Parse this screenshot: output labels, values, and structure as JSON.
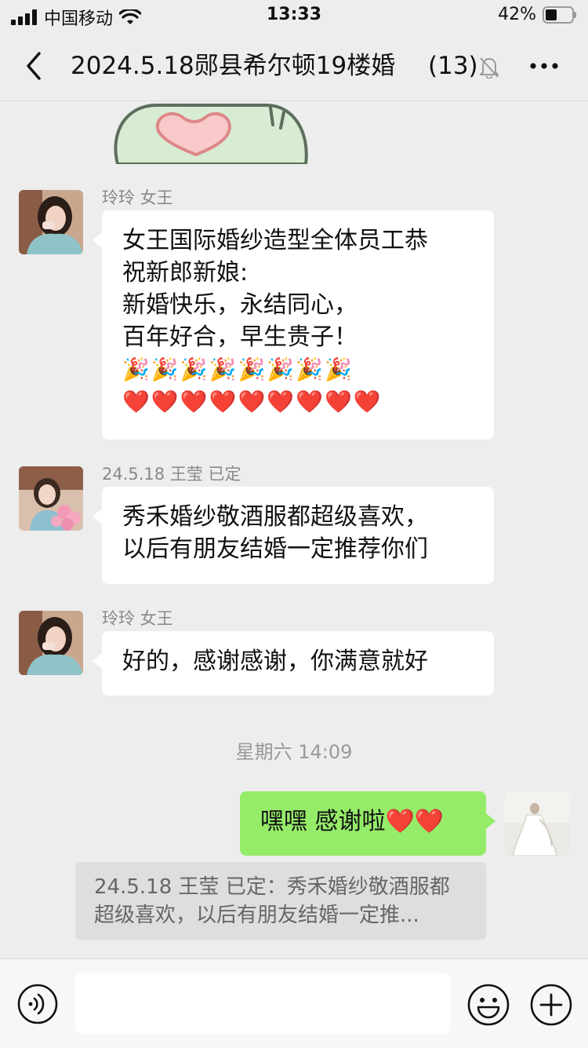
{
  "status": {
    "carrier": "中国移动",
    "time": "13:33",
    "battery": "42%"
  },
  "header": {
    "title": "2024.5.18郧县希尔顿19楼婚",
    "member_count": "(13)"
  },
  "messages": [
    {
      "sender": "玲玲 女王",
      "lines": [
        "女王国际婚纱造型全体员工恭",
        "祝新郎新娘:",
        "新婚快乐，永结同心，",
        "百年好合，早生贵子！"
      ],
      "emoji_lines": [
        "🎉🎉🎉🎉🎉🎉🎉🎉",
        "❤️❤️❤️❤️❤️❤️❤️❤️❤️"
      ]
    },
    {
      "sender": "24.5.18 王莹 已定",
      "lines": [
        "秀禾婚纱敬酒服都超级喜欢，",
        "以后有朋友结婚一定推荐你们"
      ]
    },
    {
      "sender": "玲玲 女王",
      "lines": [
        "好的，感谢感谢，你满意就好"
      ]
    }
  ],
  "divider_time": "星期六 14:09",
  "my_message": {
    "text": "嘿嘿 感谢啦❤️❤️"
  },
  "quote": {
    "lines": [
      "24.5.18 王莹 已定：秀禾婚纱敬酒服都",
      "超级喜欢，以后有朋友结婚一定推..."
    ]
  },
  "colors": {
    "background": "#ededed",
    "my_bubble": "#95ec69",
    "their_bubble": "#ffffff"
  }
}
